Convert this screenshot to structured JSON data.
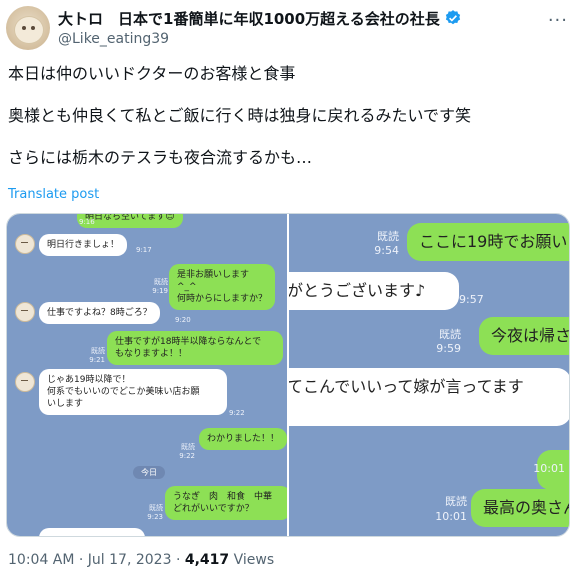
{
  "author": {
    "name": "大トロ　日本で1番簡単に年収1000万超える会社の社長",
    "handle": "@Like_eating39"
  },
  "tweet": {
    "line1": "本日は仲のいいドクターのお客様と食事",
    "line2": "奥様とも仲良くて私とご飯に行く時は独身に戻れるみたいです笑",
    "line3": "さらには栃木のテスラも夜合流するかも…",
    "translate": "Translate post"
  },
  "chat_left": {
    "top_cut": "明日なら空いてます😊",
    "t0": "9:16",
    "m1": "明日行きましょ！",
    "t1": "9:17",
    "m2a": "是非お願いします^_^",
    "m2b": "何時からにしますか？",
    "r2": "既読",
    "t2": "9:19",
    "m3": "仕事ですよね？8時ごろ？",
    "t3": "9:20",
    "m4a": "仕事ですが18時半以降ならなんとで",
    "m4b": "もなりますよ！！",
    "r4": "既読",
    "t4": "9:21",
    "m5a": "じゃあ19時以降で！",
    "m5b": "何系でもいいのでどこか美味い店お願",
    "m5c": "いします",
    "t5": "9:22",
    "m6": "わかりました！！",
    "r6": "既読",
    "t6": "9:22",
    "date": "今日",
    "m7a": "うなぎ　肉　和食　中華",
    "m7b": "どれがいいですか？",
    "r7": "既読",
    "t7": "9:23"
  },
  "chat_right": {
    "r1": "既読",
    "t1": "9:54",
    "m1": "ここに19時でお願い",
    "m2": "がとうございます♪",
    "t2": "9:57",
    "r3": "既読",
    "t3": "9:59",
    "m3": "今夜は帰さ",
    "m4": "てこんでいいって嫁が言ってます",
    "t4": "10:01",
    "r5": "既読",
    "t5": "10:01",
    "m5": "最高の奥さん"
  },
  "footer": {
    "time": "10:04 AM · Jul 17, 2023 · ",
    "views_count": "4,417",
    "views_label": " Views"
  },
  "colors": {
    "accent": "#1d9bf0",
    "chat_bg": "#7e9bc6",
    "bubble_green": "#8de055"
  },
  "icons": [
    "verified-badge-icon",
    "more-options-icon"
  ]
}
